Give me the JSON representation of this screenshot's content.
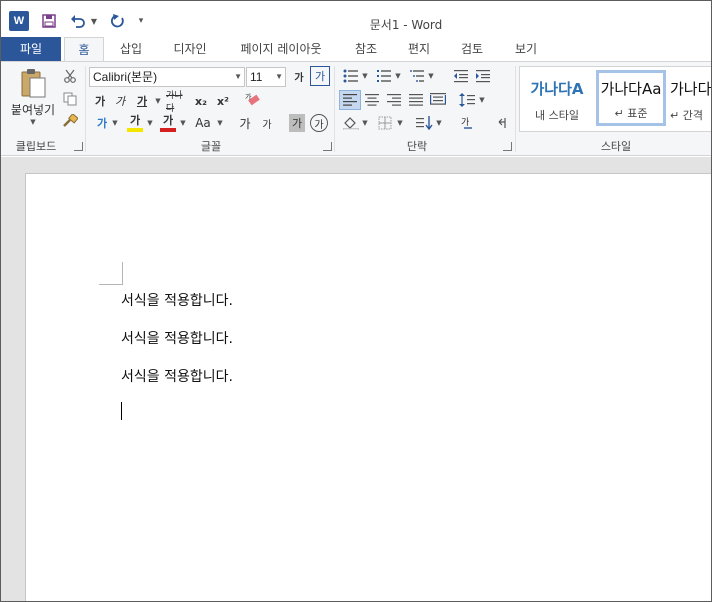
{
  "window": {
    "title": "문서1 - Word",
    "app_icon": "W"
  },
  "qat": {
    "save_icon": "save-icon",
    "undo_icon": "undo-icon",
    "redo_icon": "redo-icon"
  },
  "tabs": [
    {
      "label": "파일"
    },
    {
      "label": "홈"
    },
    {
      "label": "삽입"
    },
    {
      "label": "디자인"
    },
    {
      "label": "페이지 레이아웃"
    },
    {
      "label": "참조"
    },
    {
      "label": "편지"
    },
    {
      "label": "검토"
    },
    {
      "label": "보기"
    }
  ],
  "ribbon": {
    "clipboard": {
      "label": "클립보드",
      "paste_label": "붙여넣기"
    },
    "font": {
      "label": "글꼴",
      "font_name": "Calibri(본문)",
      "font_size": "11",
      "grow_label": "가",
      "shrink_label": "가",
      "bold_label": "가",
      "italic_label": "가",
      "underline_label": "가",
      "strike_label": "가나다",
      "sub_label": "x₂",
      "sup_label": "x²",
      "highlight_label": "가",
      "color_label": "가",
      "case_label": "Aa",
      "phonetic_label": "가",
      "char_border_label": "가",
      "enclose_label": "가",
      "shade_label": "가",
      "effect_label": "가",
      "fit_label": "가"
    },
    "paragraph": {
      "label": "단락"
    },
    "styles": {
      "label": "스타일",
      "items": [
        {
          "preview": "가나다A",
          "name": "내 스타일"
        },
        {
          "preview": "가나다Aa",
          "name": "↵ 표준"
        },
        {
          "preview": "가나다",
          "name": "↵ 간격"
        }
      ]
    }
  },
  "document": {
    "paragraphs": [
      "서식을 적용합니다.",
      "서식을 적용합니다.",
      "서식을 적용합니다."
    ]
  },
  "colors": {
    "accent": "#2b579a",
    "ribbon_bg": "#f5f6f7",
    "doc_bg": "#e3e3e3",
    "highlight": "#f5e600",
    "font_color": "#d62020"
  }
}
